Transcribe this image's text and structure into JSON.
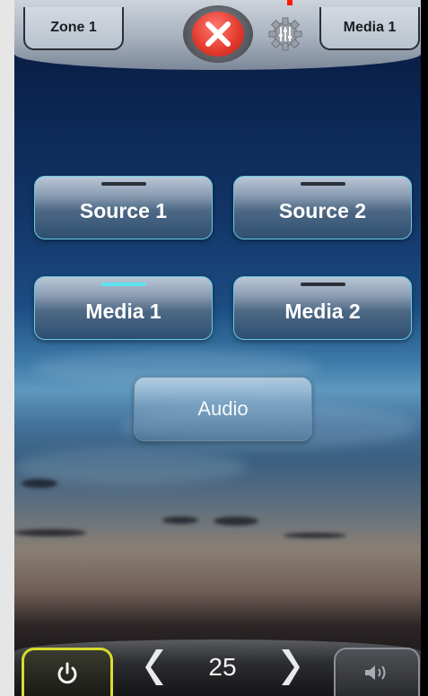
{
  "header": {
    "zone_label": "Zone 1",
    "media_label": "Media 1",
    "close_icon": "close-icon",
    "settings_icon": "gear-icon"
  },
  "sources": [
    {
      "label": "Source 1",
      "active": false
    },
    {
      "label": "Source 2",
      "active": false
    },
    {
      "label": "Media 1",
      "active": true
    },
    {
      "label": "Media 2",
      "active": false
    }
  ],
  "audio": {
    "label": "Audio"
  },
  "footer": {
    "power_icon": "power-icon",
    "prev_icon": "chevron-left-icon",
    "next_icon": "chevron-right-icon",
    "page_number": "25",
    "volume_icon": "speaker-icon"
  },
  "colors": {
    "accent": "#5de4f0",
    "power": "#d9dc2c",
    "close": "#e2382b"
  }
}
